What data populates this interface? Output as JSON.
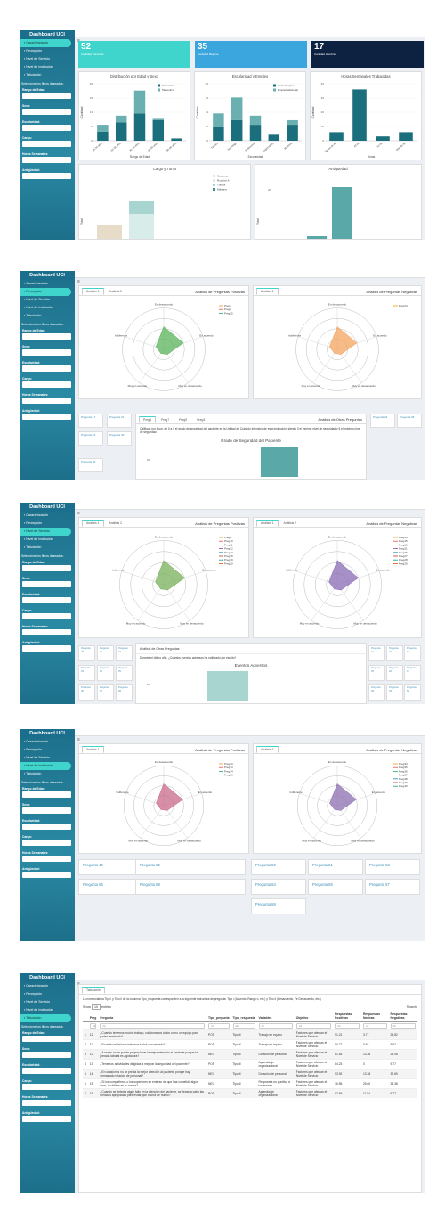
{
  "app": {
    "title": "Dashboard UCI",
    "menu_icon": "hamburger-icon"
  },
  "sidebar": {
    "items": [
      "Caracterización",
      "Percepción",
      "Nivel de Servicio",
      "Nivel de Institución",
      "Tabulación"
    ],
    "filter_title": "Seleccione los filtros deseados:",
    "filters": [
      "Rango de Edad:",
      "Sexo:",
      "Escolaridad:",
      "Cargo:",
      "Horas Semanales:",
      "Antigüedad:"
    ]
  },
  "s1": {
    "boxes": [
      {
        "value": "52",
        "label": "Cantidad Personas",
        "color": "#3fd5cd"
      },
      {
        "value": "35",
        "label": "Cantidad Mujeres",
        "color": "#3aa6dd"
      },
      {
        "value": "17",
        "label": "Cantidad Hombres",
        "color": "#0d2240"
      }
    ],
    "charts": {
      "edad": {
        "title": "Distribución por Edad y Sexo",
        "ylabel": "Cantidad",
        "xlabel": "Rango de Edad",
        "legend": [
          "Femenino",
          "Masculino"
        ]
      },
      "esc": {
        "title": "Escolaridad y Empleo",
        "ylabel": "Cantidad",
        "xlabel": "Escolaridad",
        "legend": [
          "Único Empleo",
          "Empleo adicional"
        ]
      },
      "horas": {
        "title": "Horas Semanales Trabajadas",
        "ylabel": "Cantidad",
        "xlabel": "Horas"
      },
      "cargo": {
        "title": "Cargo y Turno",
        "ylabel": "Total",
        "legend": [
          "Nocturno",
          "Rotativo A",
          "Turnos",
          "Mañana"
        ]
      },
      "ant": {
        "title": "Antigüedad",
        "ylabel": "Total"
      }
    }
  },
  "s2": {
    "tabs": [
      "Análisis 1",
      "Análisis 2"
    ],
    "pos_title": "Análisis de Preguntas Positivas",
    "neg_title": "Análisis de Preguntas Negativas",
    "radar_labels": [
      "En desacuerdo",
      "En acuerdo",
      "Muy en desacuerdo",
      "Muy en acuerdo",
      "Indiferente"
    ],
    "pos_legend": [
      "Preg1",
      "Preg2",
      "Preg25"
    ],
    "neg_legend": [
      "Preg24"
    ],
    "q_left": [
      "Pregunta 17",
      "Pregunta 22",
      "Pregunta 23",
      "Pregunta 40",
      "Pregunta 43"
    ],
    "q_right": [
      "Pregunta 24",
      "Pregunta 39"
    ],
    "other_tabs": [
      "Preg4",
      "Preg7",
      "Preg9",
      "Preg3"
    ],
    "other_title": "Análisis de Otras Preguntas",
    "question": "Califique por favor, de 0 a 5 el grado de seguridad del paciente en la Unidad de Cuidado Intensivo de esta institución, siendo 0 el mínimo nivel de seguridad y 5 el máximo nivel de seguridad.",
    "chart_title": "Grado de Seguridad del Paciente"
  },
  "s3": {
    "tabs": [
      "Análisis 1",
      "Análisis 2"
    ],
    "pos_title": "Análisis de Preguntas Positivas",
    "neg_title": "Análisis de Preguntas Negativas",
    "pos_legend": [
      "Preg8",
      "Preg10",
      "Preg11",
      "Preg12",
      "Preg13",
      "Preg18",
      "Preg19",
      "Preg20"
    ],
    "neg_legend": [
      "Preg14",
      "Preg15",
      "Preg16",
      "Preg21",
      "Preg26",
      "Preg27",
      "Preg28",
      "Preg29"
    ],
    "q_left": [
      "Pregunta 30",
      "Pregunta 31",
      "Pregunta 32",
      "Pregunta 33",
      "Pregunta 34",
      "Pregunta 35",
      "Pregunta 36",
      "Pregunta 37",
      "Pregunta 38"
    ],
    "q_right": [
      "Pregunta 41",
      "Pregunta 42",
      "Pregunta 44",
      "Pregunta 45",
      "Pregunta 46",
      "Pregunta 47",
      "Pregunta 48",
      "Pregunta 49",
      "Pregunta 50"
    ],
    "other_title": "Análisis de Otras Preguntas",
    "question": "Durante el último año, ¿Cuántos eventos adversos ha notificado por escrito?",
    "chart_title": "Eventos Adversos"
  },
  "s4": {
    "tabs": [
      "Análisis 1"
    ],
    "pos_title": "Análisis de Preguntas Positivas",
    "neg_title": "Análisis de Preguntas Negativas",
    "pos_legend": [
      "Preg10",
      "Preg13",
      "Preg14",
      "Preg16"
    ],
    "neg_legend": [
      "Preg34",
      "Preg35",
      "Preg36",
      "Preg37",
      "Preg38",
      "Preg39",
      "Preg40"
    ],
    "questions": [
      "Pregunta 49",
      "Pregunta 52",
      "Pregunta 50",
      "Pregunta 51",
      "Pregunta 53",
      "Pregunta 56",
      "Pregunta 58",
      "Pregunta 54",
      "Pregunta 55",
      "Pregunta 57",
      "Pregunta 59"
    ]
  },
  "s5": {
    "tab": "Tabulación",
    "note": "La nomenclatura Tipo i y Tipo ii de la columna Tipo_respuesta corresponden a la siguiente estructura de pregunta: Tipo i (Acuerdo, Rango o, etc.) y Tipo ii (Desacuerdo, Fe Desacuerdo, etc.)",
    "show": "Show",
    "show_n": "10",
    "entries": "entries",
    "search": "Search:",
    "headers": [
      "",
      "Preg",
      "Pregunta",
      "Tipo_pregunta",
      "Tipo_respuesta",
      "Variables",
      "Objetivo",
      "Respuestas Positivas",
      "Respuestas Neutras",
      "Respuestas Negativas"
    ],
    "all": "All",
    "rows": [
      [
        "1",
        "12",
        "¿Cuando tenemos mucho trabajo, colaboramos todos como un equipo para poder terminarlo?",
        "POS",
        "Tipo II",
        "Trabajo en equipo",
        "Factores que afectan el Nivel de Servicio",
        "91.21",
        "3.77",
        "25.82"
      ],
      [
        "2",
        "11",
        "¿En esta unidad nos tratamos todos con respeto?",
        "POS",
        "Tipo II",
        "Trabajo en equipo",
        "Factores que afectan el Nivel de Servicio",
        "80.77",
        "0.82",
        "9.62"
      ],
      [
        "3",
        "12",
        "¿A veces no se puede proporcionar la mejor atención al paciente porque la jornada laboral es agotadora?",
        "NEG",
        "Tipo II",
        "Dotación de personal",
        "Factores que afectan el Nivel de Servicio",
        "61.54",
        "13.38",
        "25.08"
      ],
      [
        "4",
        "13",
        "¿Tenemos actividades dirigidas a mejorar la seguridad del paciente?",
        "POS",
        "Tipo II",
        "Aprendizaje organizacional",
        "Factores que afectan el Nivel de Servicio",
        "84.23",
        "0",
        "9.77"
      ],
      [
        "5",
        "14",
        "¿En ocasiones no se presta la mejor atención al paciente porque hay demasiado relación de personal?",
        "NEG",
        "Tipo II",
        "Dotación de personal",
        "Factores que afectan el Nivel de Servicio",
        "53.92",
        "13.38",
        "32.69"
      ],
      [
        "6",
        "15",
        "¿Si los compañeros o los superiores se enteran de que has cometido algún error, lo utilizan en tu contra?",
        "NEG",
        "Tipo II",
        "Respuesta no punitiva a los errores",
        "Factores que afectan el Nivel de Servicio",
        "36.55",
        "25.00",
        "38.38"
      ],
      [
        "7",
        "15",
        "¿Cuando se detecta algún fallo en la atención del paciente, se llevan a cabo las medidas apropiadas para evitar que ocurra de nuevo?",
        "POS",
        "Tipo II",
        "Aprendizaje organizacional",
        "Factores que afectan el Nivel de Servicio",
        "82.69",
        "11.54",
        "5.77"
      ]
    ]
  },
  "chart_data": [
    {
      "type": "bar",
      "title": "Distribución por Edad y Sexo",
      "xlabel": "Rango de Edad",
      "ylabel": "Cantidad",
      "categories": [
        "18-25 años",
        "26-35 años",
        "36-45 años",
        "46-55 años",
        "56-65 años"
      ],
      "series": [
        {
          "name": "Femenino",
          "values": [
            4,
            8,
            12,
            9,
            1
          ]
        },
        {
          "name": "Masculino",
          "values": [
            3,
            3,
            10,
            1,
            0
          ]
        }
      ],
      "ylim": [
        0,
        25
      ]
    },
    {
      "type": "bar",
      "title": "Escolaridad y Empleo",
      "xlabel": "Escolaridad",
      "ylabel": "Cantidad",
      "categories": [
        "Técnico",
        "Tecnólogo",
        "Profesional",
        "Especialista",
        "Maestría"
      ],
      "series": [
        {
          "name": "Único Empleo",
          "values": [
            6,
            9,
            7,
            3,
            7
          ]
        },
        {
          "name": "Empleo adicional",
          "values": [
            6,
            10,
            4,
            0,
            2
          ]
        }
      ],
      "ylim": [
        0,
        25
      ]
    },
    {
      "type": "bar",
      "title": "Horas Semanales Trabajadas",
      "xlabel": "Horas",
      "ylabel": "Cantidad",
      "categories": [
        "Menos de 40",
        "40-60",
        "61-80",
        "Más de 80"
      ],
      "values": [
        6,
        36,
        3,
        6
      ],
      "ylim": [
        0,
        40
      ]
    },
    {
      "type": "bar",
      "title": "Grado de Seguridad del Paciente",
      "categories": [
        "4"
      ],
      "values": [
        18
      ]
    },
    {
      "type": "bar",
      "title": "Eventos Adversos",
      "categories": [
        "0"
      ],
      "values": [
        20
      ]
    }
  ]
}
